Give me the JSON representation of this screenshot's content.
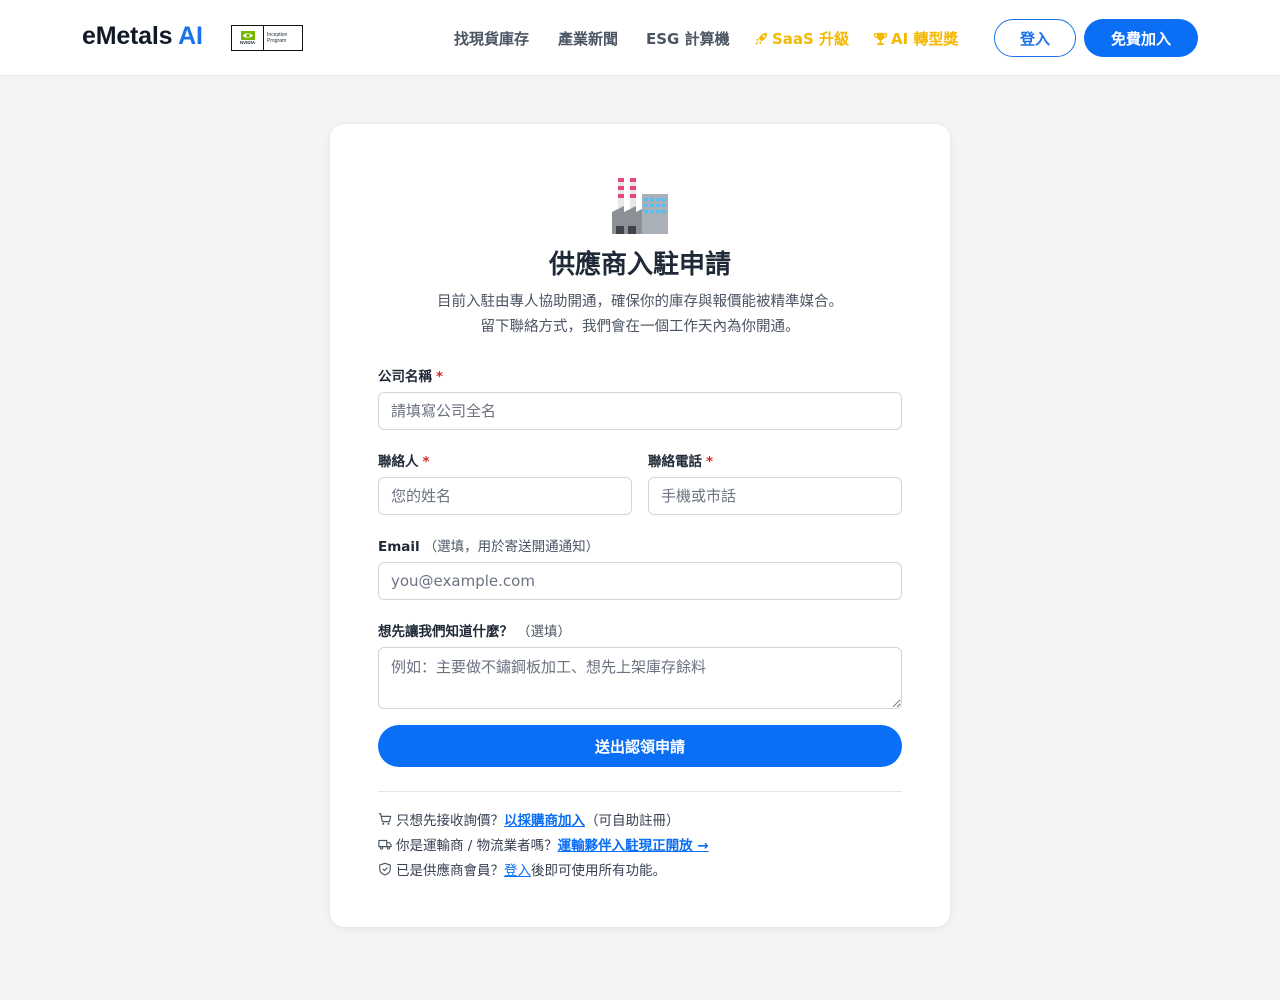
{
  "header": {
    "brand_main": "eMetals",
    "brand_ai": "AI",
    "badge_brand": "NVIDIA",
    "badge_text_1": "Inception",
    "badge_text_2": "Program",
    "nav": [
      {
        "label": "找現貨庫存",
        "icon": "none"
      },
      {
        "label": "產業新聞",
        "icon": "none"
      },
      {
        "label": "ESG 計算機",
        "icon": "none"
      },
      {
        "label": "SaaS 升級",
        "icon": "rocket-icon"
      },
      {
        "label": "AI 轉型獎",
        "icon": "trophy-icon"
      }
    ],
    "login_label": "登入",
    "join_label": "免費加入"
  },
  "form": {
    "icon": "factory-icon",
    "title": "供應商入駐申請",
    "subtitle_1": "目前入駐由專人協助開通，確保你的庫存與報價能被精準媒合。",
    "subtitle_2": "留下聯絡方式，我們會在一個工作天內為你開通。",
    "company": {
      "label": "公司名稱",
      "required": "*",
      "placeholder": "請填寫公司全名"
    },
    "contact": {
      "label": "聯絡人",
      "required": "*",
      "placeholder": "您的姓名"
    },
    "phone": {
      "label": "聯絡電話",
      "required": "*",
      "placeholder": "手機或市話"
    },
    "email": {
      "label": "Email",
      "hint": "（選填，用於寄送開通通知）",
      "placeholder": "you@example.com"
    },
    "note": {
      "label": "想先讓我們知道什麼？",
      "hint": "（選填）",
      "placeholder": "例如：主要做不鏽鋼板加工、想先上架庫存餘料"
    },
    "submit_label": "送出認領申請"
  },
  "footer_links": {
    "buyer_prefix": "只想先接收詢價？",
    "buyer_link": "以採購商加入",
    "buyer_suffix": "（可自助註冊）",
    "logistics_prefix": "你是運輸商 / 物流業者嗎？",
    "logistics_link": "運輸夥伴入駐現正開放 →",
    "member_prefix": "已是供應商會員？",
    "member_link": "登入",
    "member_suffix": "後即可使用所有功能。"
  },
  "colors": {
    "accent": "#0b6ff5",
    "gold": "#f5b800",
    "required": "#dc2626"
  }
}
